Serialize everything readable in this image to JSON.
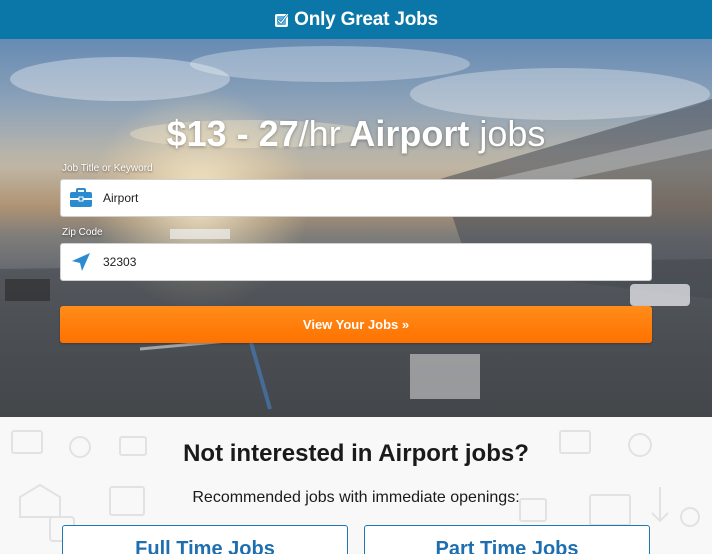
{
  "header": {
    "brand_name": "Only Great Jobs",
    "brand_icon": "checkbox-logo-icon",
    "bar_color": "#0b77a8"
  },
  "hero": {
    "title_pay": "$13 - 27",
    "title_unit": "/hr",
    "title_keyword": "Airport",
    "title_suffix": "jobs",
    "keyword_label": "Job Title or Keyword",
    "keyword_value": "Airport",
    "keyword_icon": "briefcase-icon",
    "zip_label": "Zip Code",
    "zip_value": "32303",
    "zip_icon": "location-arrow-icon",
    "cta_label": "View Your Jobs »",
    "cta_color": "#ff7a00"
  },
  "recommendations": {
    "title": "Not interested in Airport jobs?",
    "subtitle": "Recommended jobs with immediate openings:",
    "options": [
      {
        "label": "Full Time Jobs"
      },
      {
        "label": "Part Time Jobs"
      }
    ],
    "link_color": "#1f6fb0"
  }
}
